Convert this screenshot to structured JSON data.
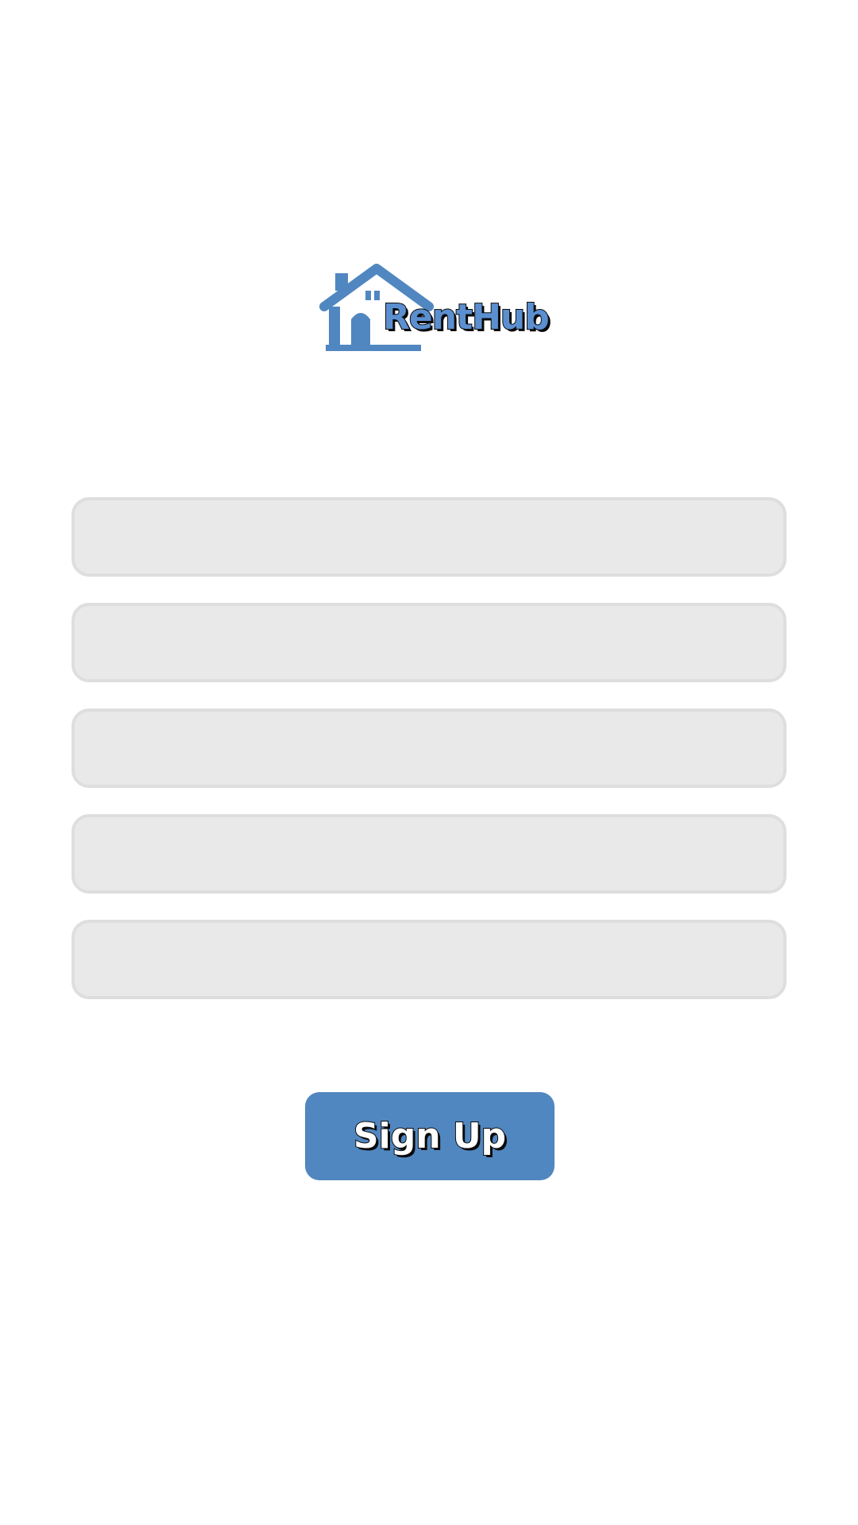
{
  "app": {
    "name": "RentHub",
    "logo_icon": "house-icon",
    "brand_color": "#5187c0"
  },
  "form": {
    "fields": [
      {
        "value": "",
        "placeholder": ""
      },
      {
        "value": "",
        "placeholder": ""
      },
      {
        "value": "",
        "placeholder": ""
      },
      {
        "value": "",
        "placeholder": ""
      },
      {
        "value": "",
        "placeholder": ""
      }
    ],
    "field_background": "#e9e9e9",
    "field_border": "#dedede"
  },
  "actions": {
    "signup_label": "Sign Up"
  }
}
